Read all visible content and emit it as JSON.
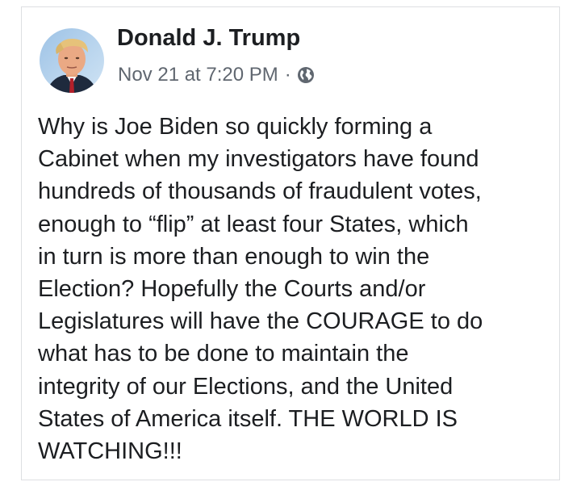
{
  "post": {
    "author": {
      "name": "Donald J. Trump",
      "avatar_icon": "profile-photo"
    },
    "timestamp": "Nov 21 at 7:20 PM",
    "separator": "·",
    "audience_icon": "globe-icon",
    "body": "Why is Joe Biden so quickly forming a\nCabinet when my investigators have found\nhundreds of thousands of fraudulent votes,\nenough to “flip” at least four States, which\nin turn is more than enough to win the\nElection? Hopefully the Courts and/or\nLegislatures will have the COURAGE to do\nwhat has to be done to maintain the\nintegrity of our Elections,  and the United\nStates of America itself. THE WORLD IS\nWATCHING!!!"
  },
  "colors": {
    "text_primary": "#1c1e21",
    "text_secondary": "#606770",
    "card_border": "#dddfe2",
    "background": "#ffffff"
  }
}
